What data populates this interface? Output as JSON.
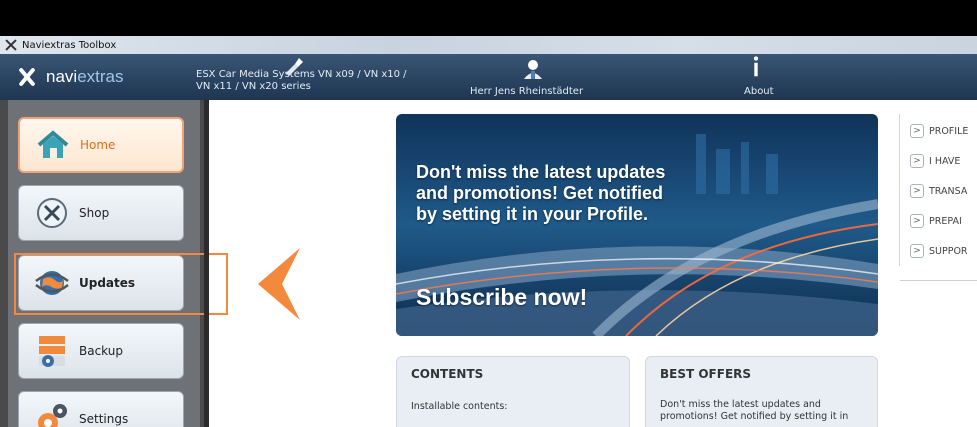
{
  "window": {
    "title": "Naviextras Toolbox"
  },
  "toolbar": {
    "logo_text_a": "navi",
    "logo_text_b": "extras",
    "device_line1": "ESX Car Media Systems VN x09 / VN x10 /",
    "device_line2": "VN x11 / VN x20 series",
    "user_label": "Herr Jens Rheinstädter",
    "about_label": "About"
  },
  "sidebar": {
    "items": [
      {
        "label": "Home",
        "icon": "home-icon",
        "active": true
      },
      {
        "label": "Shop",
        "icon": "shop-icon"
      },
      {
        "label": "Updates",
        "icon": "globe-updates-icon"
      },
      {
        "label": "Backup",
        "icon": "backup-icon"
      },
      {
        "label": "Settings",
        "icon": "settings-gear-icon"
      }
    ]
  },
  "banner": {
    "headline": "Don't miss the latest updates and promotions! Get notified by setting it in your Profile.",
    "cta": "Subscribe now!"
  },
  "cards": {
    "contents": {
      "title": "CONTENTS",
      "text": "Installable contents:"
    },
    "offers": {
      "title": "BEST OFFERS",
      "text": "Don't miss the latest updates and promotions! Get notified by setting it in"
    }
  },
  "right_panel": {
    "items": [
      "PROFILE",
      "I HAVE",
      "TRANSA",
      "PREPAI",
      "SUPPOR"
    ]
  },
  "colors": {
    "accent": "#f2893d",
    "toolbar": "#2b4563"
  }
}
